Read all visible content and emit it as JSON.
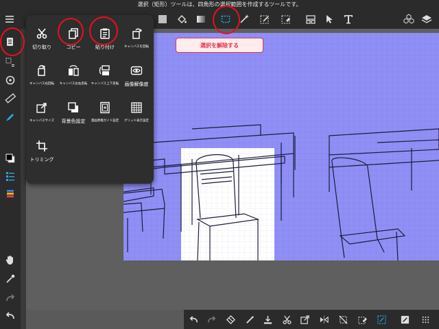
{
  "status_bar": {
    "text": "選択（矩形）ツールは、四角形の選択範囲を作成するツールです。"
  },
  "selection": {
    "deselect_label": "選択を解除する"
  },
  "edit_menu": {
    "items": [
      {
        "label": "切り取り",
        "icon": "scissors-icon"
      },
      {
        "label": "コピー",
        "icon": "copy-icon"
      },
      {
        "label": "貼り付け",
        "icon": "paste-icon"
      },
      {
        "label": "キャンバスを回転",
        "icon": "rotate-canvas-icon"
      },
      {
        "label": "キャンバス右回転",
        "icon": "rotate-right-icon"
      },
      {
        "label": "キャンバス左右反転",
        "icon": "flip-horizontal-icon"
      },
      {
        "label": "キャンバス上下反転",
        "icon": "flip-vertical-icon"
      },
      {
        "label": "画像解像度",
        "icon": "eye-icon"
      },
      {
        "label": "キャンバスサイズ",
        "icon": "canvas-size-icon"
      },
      {
        "label": "背景色設定",
        "icon": "background-color-icon"
      },
      {
        "label": "漫画原稿ガイド設定",
        "icon": "comic-guide-icon"
      },
      {
        "label": "グリッド表示設定",
        "icon": "grid-icon"
      },
      {
        "label": "トリミング",
        "icon": "trim-icon"
      }
    ]
  },
  "colors": {
    "accent_red": "#e8101e",
    "selection_blue": "#8f8ff5",
    "toolbar_bg": "#2b2b2b",
    "menu_bg": "#2e2e2e",
    "active_cyan": "#2aa7e0"
  }
}
